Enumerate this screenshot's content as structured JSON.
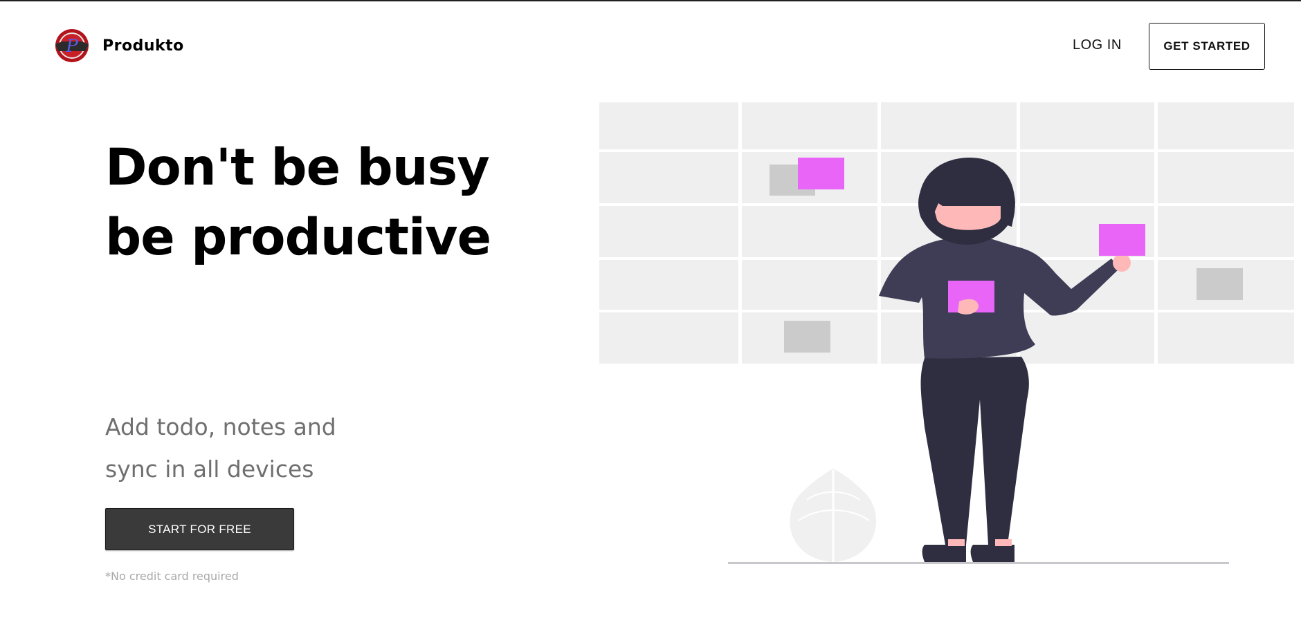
{
  "header": {
    "brand_name": "Produkto",
    "logo_letter": "P",
    "login_label": "LOG IN",
    "get_started_label": "GET STARTED"
  },
  "hero": {
    "headline_line1": "Don't be busy",
    "headline_line2": "be productive",
    "subtext_line1": "Add todo, notes and",
    "subtext_line2": "sync in all devices",
    "cta_label": "START FOR FREE",
    "note": "*No credit card required"
  },
  "colors": {
    "accent_note": "#e865f8",
    "figure_dark": "#3f3d56",
    "figure_pants": "#2f2e41",
    "skin": "#ffb8b8",
    "grid_cell": "#efefef",
    "gray_note": "#cbcbcb",
    "cta_bg": "#3a3a3a"
  },
  "icons": {
    "logo": "produkto-logo-icon"
  }
}
